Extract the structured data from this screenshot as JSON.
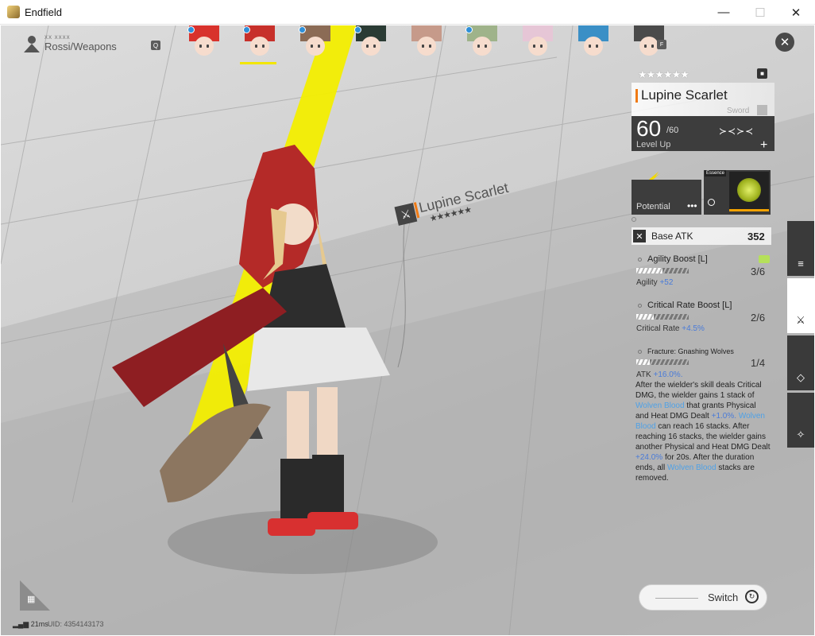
{
  "window": {
    "title": "Endfield",
    "minimize": "—",
    "maximize": "☐",
    "close": "✕"
  },
  "breadcrumb": {
    "small": "XX XXXX",
    "text": "Rossi/Weapons",
    "search_key": "Q"
  },
  "team_switch_key": "F",
  "avatars": [
    {
      "hair": "#d8322c",
      "online": true
    },
    {
      "hair": "#c7302a",
      "online": true,
      "selected": true
    },
    {
      "hair": "#8b6b55",
      "online": true
    },
    {
      "hair": "#2a3b34",
      "online": true
    },
    {
      "hair": "#c69a8a",
      "online": false
    },
    {
      "hair": "#9fb38a",
      "online": true
    },
    {
      "hair": "#e6c6d6",
      "online": false
    },
    {
      "hair": "#3a8fc6",
      "online": false
    },
    {
      "hair": "#4a4a4a",
      "online": false
    }
  ],
  "weapon": {
    "name": "Lupine Scarlet",
    "rarity_stars": "★★★★★★",
    "type": "Sword",
    "level": "60",
    "level_max": "/60",
    "level_up_label": "Level Up",
    "potential_label": "Potential",
    "essence_tag": "Essence",
    "base_atk_label": "Base ATK",
    "base_atk_value": "352"
  },
  "traits": [
    {
      "name": "Agility Boost [L]",
      "rank": "3/6",
      "fill": 0.5,
      "stat_label": "Agility",
      "stat_value": "+52"
    },
    {
      "name": "Critical Rate Boost [L]",
      "rank": "2/6",
      "fill": 0.33,
      "stat_label": "Critical Rate",
      "stat_value": "+4.5%"
    },
    {
      "name": "Fracture: Gnashing Wolves",
      "rank": "1/4",
      "fill": 0.25,
      "stat_label": "ATK",
      "stat_value": "+16.0%.",
      "desc_1": "After the wielder's skill deals Critical DMG, the wielder gains 1 stack of ",
      "desc_hl_1": "Wolven Blood",
      "desc_2": " that grants Physical and Heat DMG Dealt ",
      "desc_bl_1": "+1.0%.",
      "desc_3": " ",
      "desc_hl_2": "Wolven Blood",
      "desc_4": " can reach 16 stacks. After reaching 16 stacks, the wielder gains another Physical and Heat DMG Dealt ",
      "desc_bl_2": "+24.0%",
      "desc_5": " for 20s. After the duration ends, all ",
      "desc_hl_3": "Wolven Blood",
      "desc_6": " stacks are removed."
    }
  ],
  "side_tabs": [
    {
      "icon": "≡",
      "active": false
    },
    {
      "icon": "⚔",
      "active": true
    },
    {
      "icon": "◇",
      "active": false
    },
    {
      "icon": "✧",
      "active": false
    }
  ],
  "switch_button": {
    "label": "Switch",
    "icon": "↻"
  },
  "status": {
    "ping": "21ms",
    "uid": "UID: 4354143173"
  },
  "grid_glyph": "▦",
  "close_glyph": "✕",
  "lock_glyph": "🔒",
  "plus_glyph": "+",
  "level_pips": "≻≺≻≺",
  "potential_dots": "•••",
  "atk_glyph": "✕"
}
